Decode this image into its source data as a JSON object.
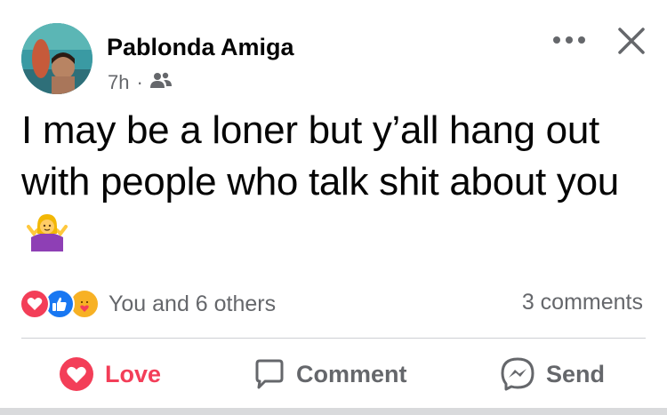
{
  "post": {
    "author": "Pablonda Amiga",
    "time": "7h",
    "separator": "·",
    "audience_icon": "friends-icon",
    "text": "I may be a loner but y’all hang out with people who talk shit about you",
    "emoji": "woman-shrugging-emoji"
  },
  "reactions": {
    "icons": [
      "love-reaction-icon",
      "like-reaction-icon",
      "care-reaction-icon"
    ],
    "summary": "You and 6 others",
    "comments": "3 comments"
  },
  "actions": {
    "love_label": "Love",
    "comment_label": "Comment",
    "send_label": "Send"
  },
  "colors": {
    "love": "#f33e58",
    "like": "#1877f2",
    "secondary_text": "#65676b"
  }
}
